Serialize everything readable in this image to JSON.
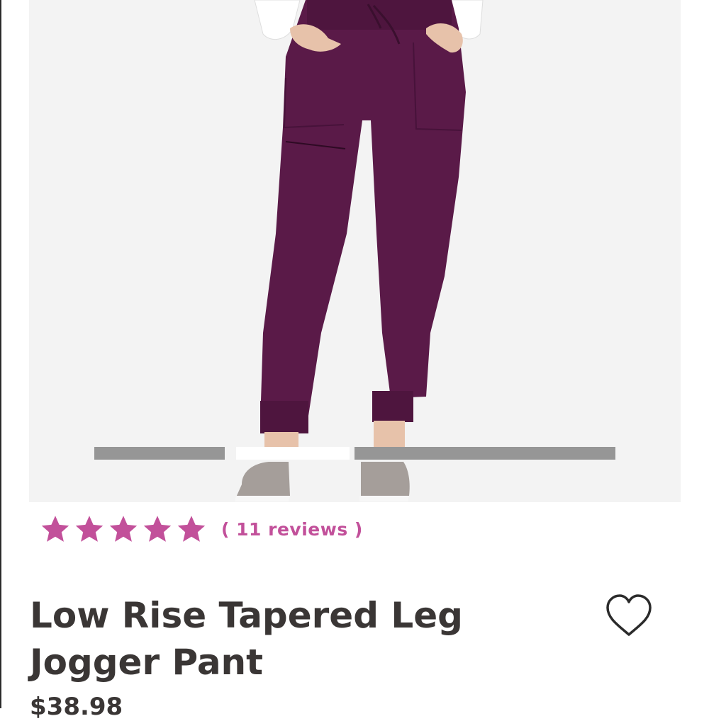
{
  "product": {
    "image": {
      "alt": "Plum low rise jogger pant worn by model in white top and grey slip-on shoes",
      "pant_color": "#5a1a48",
      "background": "#f3f3f3"
    },
    "carousel": {
      "slides": 3,
      "active_index": 1
    },
    "rating": {
      "stars": 5,
      "star_color": "#c2509a",
      "reviews_label": "( 11 reviews )"
    },
    "title": "Low Rise Tapered Leg Jogger Pant",
    "price": "$38.98",
    "wishlist_icon": "heart-outline-icon"
  }
}
